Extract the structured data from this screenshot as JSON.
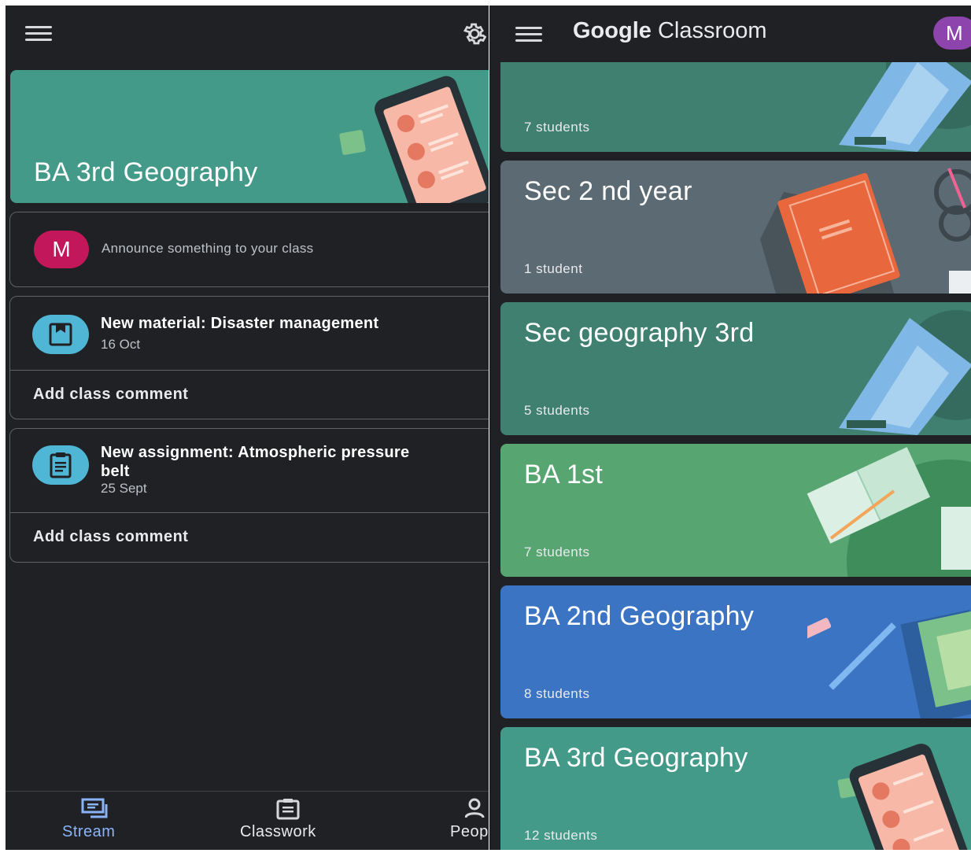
{
  "left_pane": {
    "class_title": "BA 3rd Geography",
    "announce_avatar": "M",
    "announce_placeholder": "Announce something to your class",
    "posts": [
      {
        "title": "New material: Disaster management",
        "date": "16 Oct",
        "icon": "material-icon",
        "comment_label": "Add class comment"
      },
      {
        "title": "New assignment: Atmospheric pressure belt",
        "date": "25 Sept",
        "icon": "assignment-icon",
        "comment_label": "Add class comment"
      }
    ],
    "bottom_nav": [
      {
        "label": "Stream",
        "icon": "stream-icon",
        "active": true
      },
      {
        "label": "Classwork",
        "icon": "classwork-icon",
        "active": false
      },
      {
        "label": "People",
        "icon": "people-icon",
        "active": false
      }
    ]
  },
  "right_pane": {
    "brand": {
      "google": "Google",
      "product": "Classroom"
    },
    "account_avatar": "M",
    "classes": [
      {
        "title": "",
        "count": "7 students",
        "color": "#3f8070"
      },
      {
        "title": "Sec 2 nd year",
        "count": "1 student",
        "color": "#5c6a73"
      },
      {
        "title": "Sec geography 3rd",
        "count": "5 students",
        "color": "#3f8070"
      },
      {
        "title": "BA 1st",
        "count": "7 students",
        "color": "#57a672"
      },
      {
        "title": "BA 2nd Geography",
        "count": "8 students",
        "color": "#3a74c2"
      },
      {
        "title": "BA 3rd Geography",
        "count": "12 students",
        "color": "#449a89"
      }
    ]
  },
  "colors": {
    "dark_bg": "#202124",
    "active_nav": "#8ab4f8",
    "post_icon": "#4fb6d6"
  }
}
